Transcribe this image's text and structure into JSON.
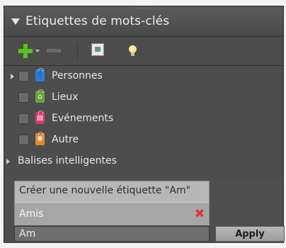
{
  "panel": {
    "title": "Etiquettes de mots-clés",
    "icons": {
      "collapse": "triangle-down",
      "add": "plus-icon",
      "add_menu": "chevron-down-icon",
      "remove": "minus-icon",
      "tag_photo": "photo-icon",
      "find_tags": "lightbulb-icon"
    }
  },
  "tree": {
    "categories": [
      {
        "label": "Personnes",
        "icon": "person-icon",
        "color": "#2f7fd4",
        "glyph": "👤",
        "expandable": true
      },
      {
        "label": "Lieux",
        "icon": "building-icon",
        "color": "#6aa23a",
        "glyph": "⌂",
        "expandable": false
      },
      {
        "label": "Evénements",
        "icon": "event-icon",
        "color": "#d23a6a",
        "glyph": "▤",
        "expandable": false
      },
      {
        "label": "Autre",
        "icon": "other-icon",
        "color": "#e48a2c",
        "glyph": "✱",
        "expandable": false
      }
    ],
    "smart_tags": {
      "label": "Balises intelligentes"
    }
  },
  "autocomplete": {
    "create_text": "Créer une nouvelle étiquette \"Am\"",
    "suggestion": "Amis",
    "suggestion_delete_color": "#e23535"
  },
  "entry": {
    "value": "Am",
    "apply_label": "Apply"
  }
}
